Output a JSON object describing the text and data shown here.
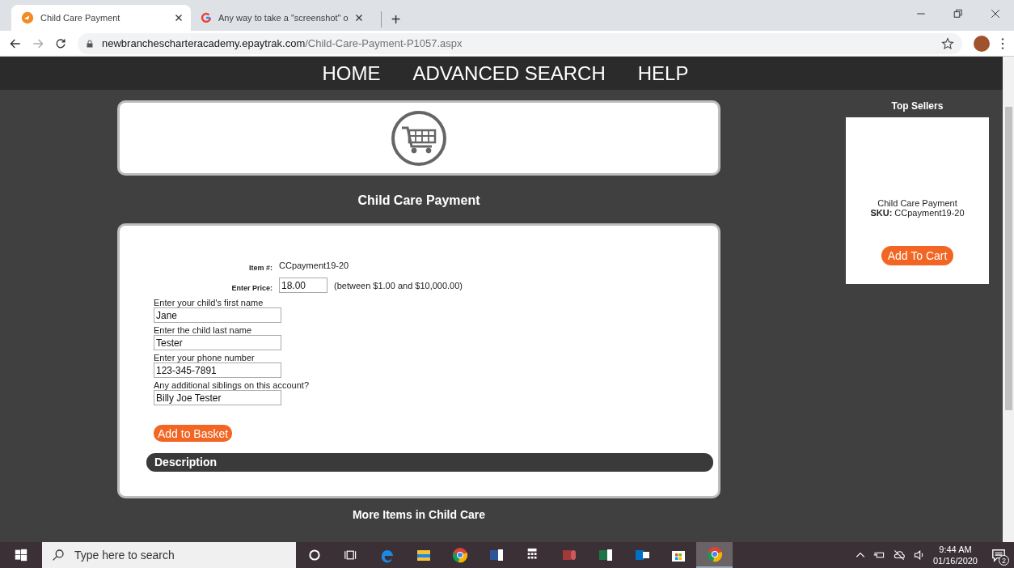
{
  "browser": {
    "tabs": [
      {
        "title": "Child Care Payment",
        "selected": true,
        "kind": "site"
      },
      {
        "title": "Any way to take a \"screenshot\" o",
        "selected": false,
        "kind": "google"
      }
    ],
    "new_tab": "+",
    "address": {
      "host": "newbranchescharteracademy.epaytrak.com",
      "path": "/Child-Care-Payment-P1057.aspx"
    }
  },
  "nav": [
    {
      "label": "HOME"
    },
    {
      "label": "ADVANCED SEARCH"
    },
    {
      "label": "HELP"
    }
  ],
  "product": {
    "title": "Child Care Payment",
    "item_label": "Item #:",
    "item_value": "CCpayment19-20",
    "price_label": "Enter Price:",
    "price_value": "18.00",
    "price_hint": "(between $1.00 and $10,000.00)",
    "fields": [
      {
        "label": "Enter your child's first name",
        "value": "Jane"
      },
      {
        "label": "Enter the child last name",
        "value": "Tester"
      },
      {
        "label": "Enter your phone number",
        "value": "123-345-7891"
      },
      {
        "label": "Any additional siblings on this account?",
        "value": "Billy Joe Tester"
      }
    ],
    "add_button": "Add to Basket",
    "description_heading": "Description"
  },
  "more_items": "More Items in Child Care",
  "top_sellers": {
    "heading": "Top Sellers",
    "items": [
      {
        "name": "Child Care Payment",
        "sku_label": "SKU:",
        "sku": "CCpayment19-20",
        "button": "Add To Cart"
      }
    ]
  },
  "taskbar": {
    "search_placeholder": "Type here to search",
    "apps": [
      {
        "kind": "cortana",
        "selected": false
      },
      {
        "kind": "taskview",
        "selected": false
      },
      {
        "kind": "edge",
        "selected": false
      },
      {
        "kind": "folder",
        "selected": false
      },
      {
        "kind": "chrome",
        "selected": false
      },
      {
        "kind": "word",
        "selected": false
      },
      {
        "kind": "calculator",
        "selected": false
      },
      {
        "kind": "access",
        "selected": false
      },
      {
        "kind": "excel",
        "selected": false
      },
      {
        "kind": "outlook",
        "selected": false
      },
      {
        "kind": "store",
        "selected": false
      },
      {
        "kind": "chrome",
        "selected": true
      }
    ],
    "time": "9:44 AM",
    "date": "01/16/2020",
    "notifications": "2"
  }
}
